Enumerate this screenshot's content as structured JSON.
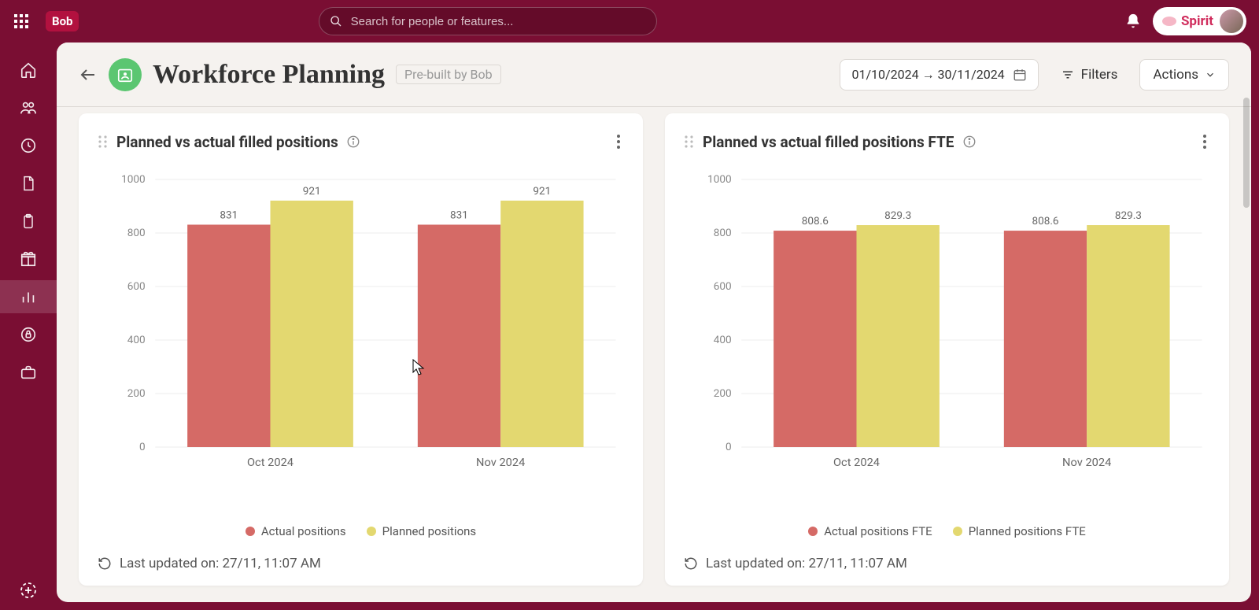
{
  "brand_logo": "Bob",
  "search": {
    "placeholder": "Search for people or features..."
  },
  "user": {
    "name": "Spirit"
  },
  "page": {
    "title": "Workforce Planning",
    "prebuilt_label": "Pre-built by Bob",
    "date_range": "01/10/2024 → 30/11/2024",
    "filters_label": "Filters",
    "actions_label": "Actions"
  },
  "cards": [
    {
      "title": "Planned vs actual filled positions",
      "legend": {
        "actual": "Actual positions",
        "planned": "Planned positions"
      },
      "footer": "Last updated on: 27/11, 11:07 AM"
    },
    {
      "title": "Planned vs actual filled positions FTE",
      "legend": {
        "actual": "Actual positions FTE",
        "planned": "Planned positions FTE"
      },
      "footer": "Last updated on: 27/11, 11:07 AM"
    }
  ],
  "chart_data": [
    {
      "type": "bar",
      "title": "Planned vs actual filled positions",
      "categories": [
        "Oct 2024",
        "Nov 2024"
      ],
      "series": [
        {
          "name": "Actual positions",
          "values": [
            831,
            831
          ],
          "color": "#d56a66"
        },
        {
          "name": "Planned positions",
          "values": [
            921,
            921
          ],
          "color": "#e3d870"
        }
      ],
      "ylim": [
        0,
        1000
      ],
      "yticks": [
        0,
        200,
        400,
        600,
        800,
        1000
      ],
      "xlabel": "",
      "ylabel": ""
    },
    {
      "type": "bar",
      "title": "Planned vs actual filled positions FTE",
      "categories": [
        "Oct 2024",
        "Nov 2024"
      ],
      "series": [
        {
          "name": "Actual positions FTE",
          "values": [
            808.6,
            808.6
          ],
          "color": "#d56a66"
        },
        {
          "name": "Planned positions FTE",
          "values": [
            829.3,
            829.3
          ],
          "color": "#e3d870"
        }
      ],
      "ylim": [
        0,
        1000
      ],
      "yticks": [
        0,
        200,
        400,
        600,
        800,
        1000
      ],
      "xlabel": "",
      "ylabel": ""
    }
  ],
  "nav_icons": [
    "home",
    "people",
    "clock",
    "document",
    "clipboard",
    "gift",
    "analytics",
    "security",
    "briefcase"
  ]
}
